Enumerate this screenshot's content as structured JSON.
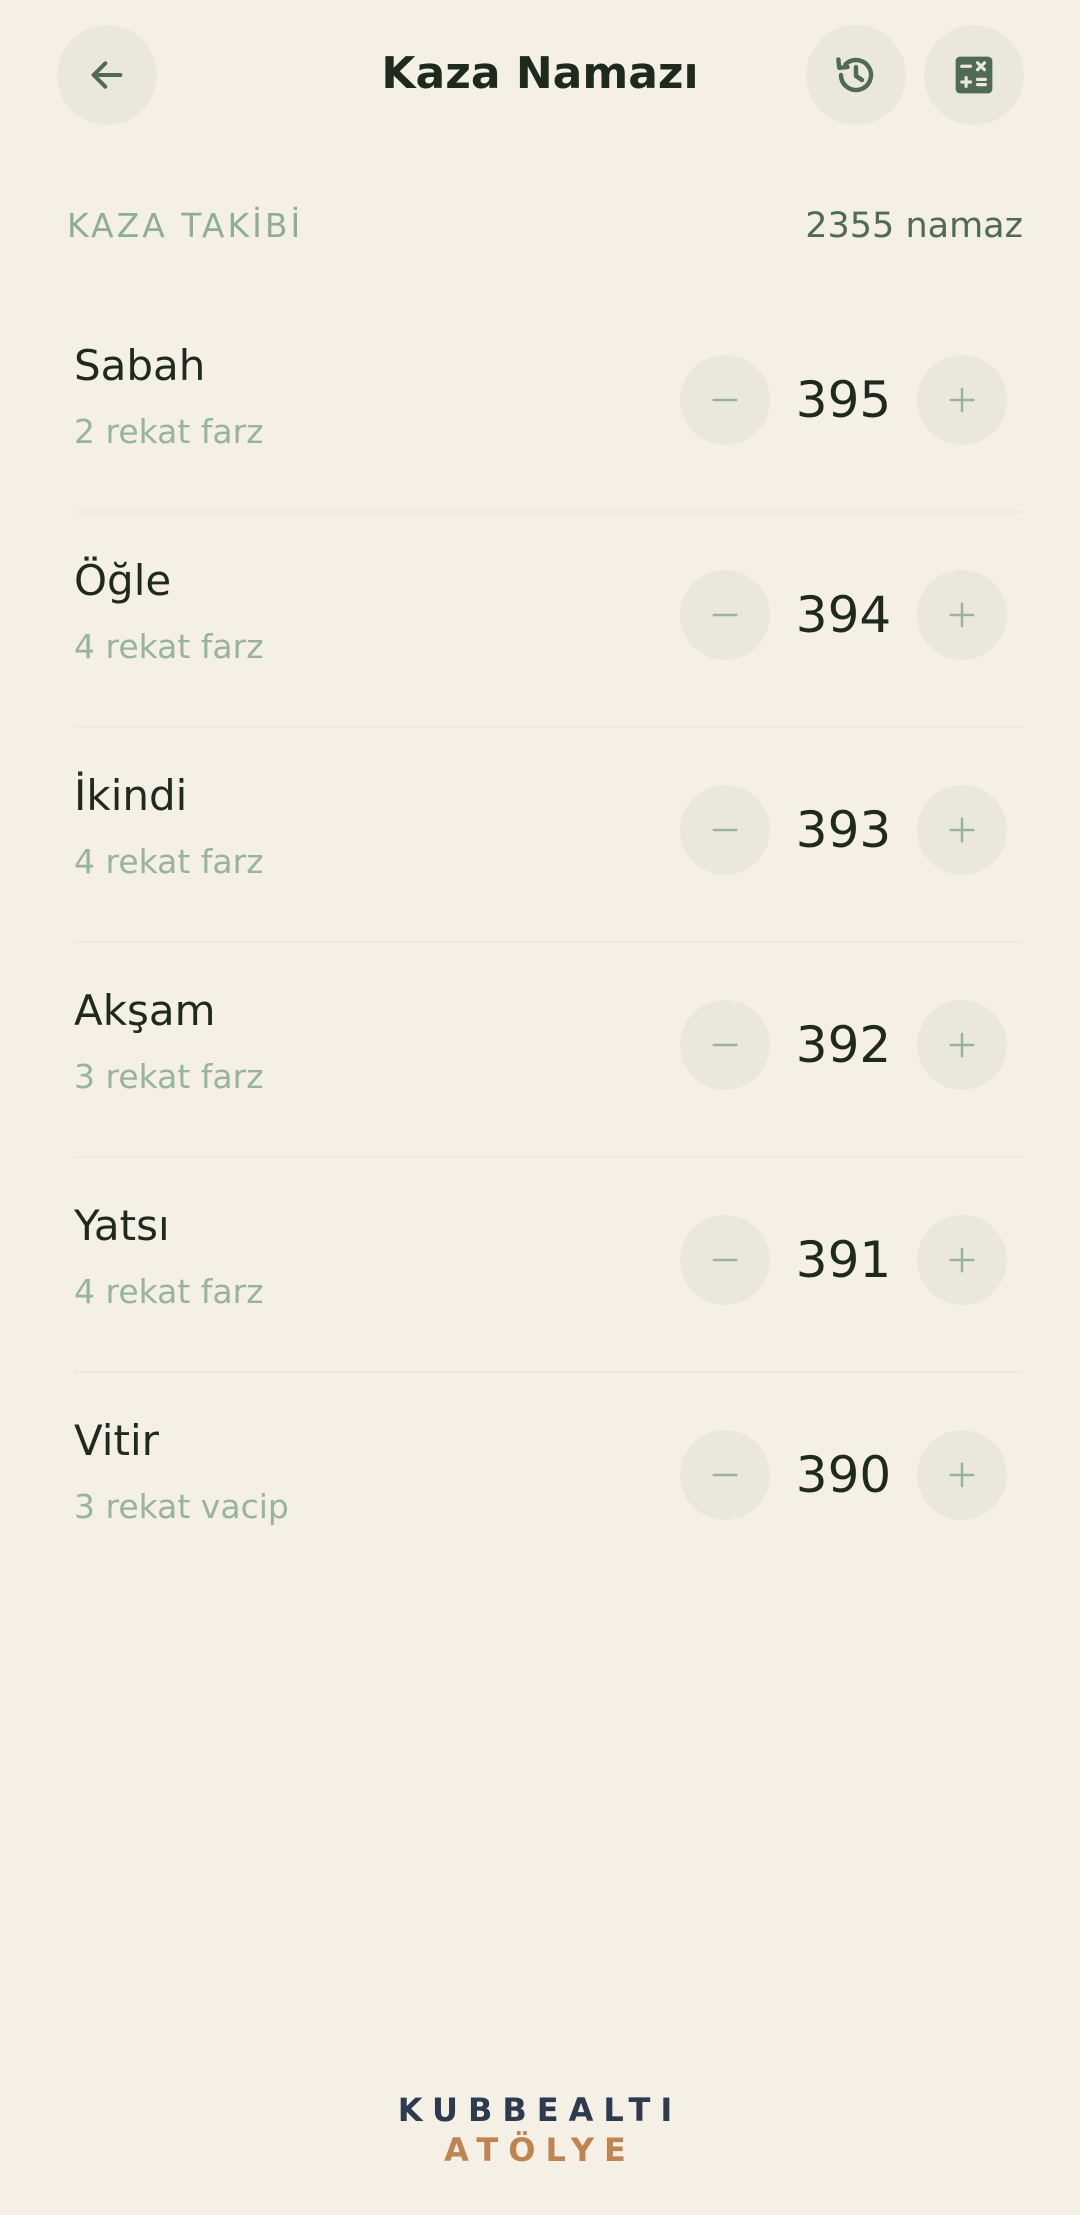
{
  "header": {
    "title": "Kaza Namazı",
    "back_icon": "arrow-left-icon",
    "history_icon": "history-icon",
    "calculator_icon": "calculator-icon"
  },
  "summary": {
    "label": "KAZA TAKİBİ",
    "total": "2355 namaz"
  },
  "prayers": [
    {
      "name": "Sabah",
      "detail": "2 rekat farz",
      "count": "395"
    },
    {
      "name": "Öğle",
      "detail": "4 rekat farz",
      "count": "394"
    },
    {
      "name": "İkindi",
      "detail": "4 rekat farz",
      "count": "393"
    },
    {
      "name": "Akşam",
      "detail": "3 rekat farz",
      "count": "392"
    },
    {
      "name": "Yatsı",
      "detail": "4 rekat farz",
      "count": "391"
    },
    {
      "name": "Vitir",
      "detail": "3 rekat vacip",
      "count": "390"
    }
  ],
  "footer": {
    "brand_line1": "KUBBEALTI",
    "brand_line2": "ATÖLYE"
  },
  "colors": {
    "background": "#F5F0E6",
    "button_bg": "#EAE8DC",
    "accent_green": "#4F6B56",
    "muted_green": "#98B49C",
    "brand_navy": "#2E3B4E",
    "brand_copper": "#C08452"
  }
}
